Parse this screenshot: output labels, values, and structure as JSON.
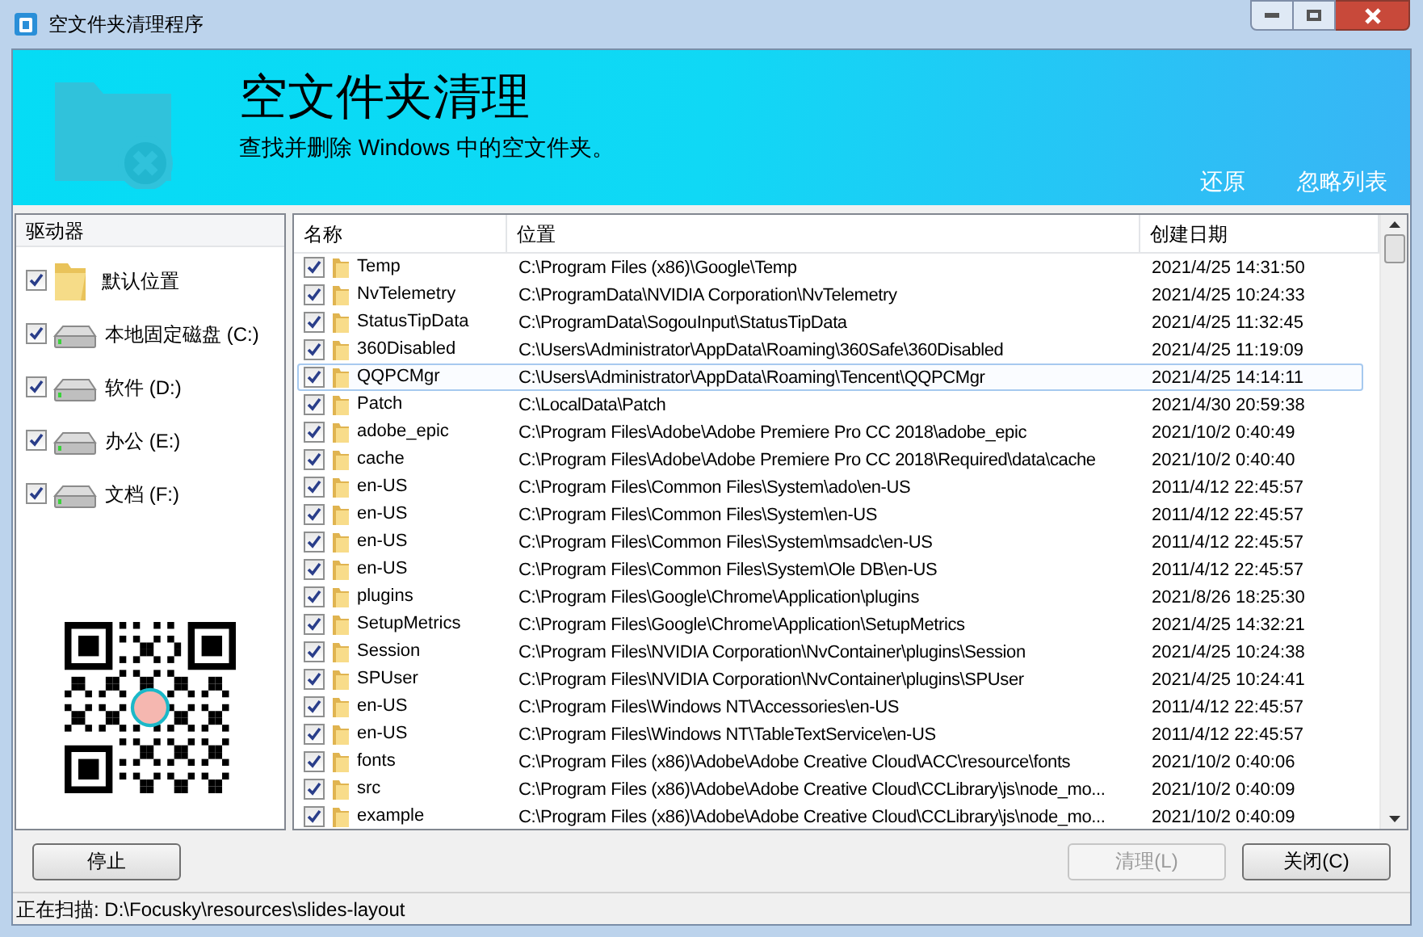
{
  "window": {
    "title": "空文件夹清理程序"
  },
  "header": {
    "title": "空文件夹清理",
    "subtitle": "查找并删除 Windows 中的空文件夹。",
    "links": [
      "还原",
      "忽略列表"
    ]
  },
  "drives": {
    "heading": "驱动器",
    "items": [
      {
        "kind": "folder",
        "label": "默认位置",
        "checked": true
      },
      {
        "kind": "drive",
        "label": "本地固定磁盘 (C:)",
        "checked": true
      },
      {
        "kind": "drive",
        "label": "软件 (D:)",
        "checked": true
      },
      {
        "kind": "drive",
        "label": "办公 (E:)",
        "checked": true
      },
      {
        "kind": "drive",
        "label": "文档 (F:)",
        "checked": true
      }
    ]
  },
  "table": {
    "columns": [
      "名称",
      "位置",
      "创建日期"
    ],
    "rows": [
      {
        "name": "Temp",
        "path": "C:\\Program Files (x86)\\Google\\Temp",
        "date": "2021/4/25 14:31:50",
        "checked": true,
        "selected": false
      },
      {
        "name": "NvTelemetry",
        "path": "C:\\ProgramData\\NVIDIA Corporation\\NvTelemetry",
        "date": "2021/4/25 10:24:33",
        "checked": true,
        "selected": false
      },
      {
        "name": "StatusTipData",
        "path": "C:\\ProgramData\\SogouInput\\StatusTipData",
        "date": "2021/4/25 11:32:45",
        "checked": true,
        "selected": false
      },
      {
        "name": "360Disabled",
        "path": "C:\\Users\\Administrator\\AppData\\Roaming\\360Safe\\360Disabled",
        "date": "2021/4/25 11:19:09",
        "checked": true,
        "selected": false
      },
      {
        "name": "QQPCMgr",
        "path": "C:\\Users\\Administrator\\AppData\\Roaming\\Tencent\\QQPCMgr",
        "date": "2021/4/25 14:14:11",
        "checked": true,
        "selected": true
      },
      {
        "name": "Patch",
        "path": "C:\\LocalData\\Patch",
        "date": "2021/4/30 20:59:38",
        "checked": true,
        "selected": false
      },
      {
        "name": "adobe_epic",
        "path": "C:\\Program Files\\Adobe\\Adobe Premiere Pro CC 2018\\adobe_epic",
        "date": "2021/10/2 0:40:49",
        "checked": true,
        "selected": false
      },
      {
        "name": "cache",
        "path": "C:\\Program Files\\Adobe\\Adobe Premiere Pro CC 2018\\Required\\data\\cache",
        "date": "2021/10/2 0:40:40",
        "checked": true,
        "selected": false
      },
      {
        "name": "en-US",
        "path": "C:\\Program Files\\Common Files\\System\\ado\\en-US",
        "date": "2011/4/12 22:45:57",
        "checked": true,
        "selected": false
      },
      {
        "name": "en-US",
        "path": "C:\\Program Files\\Common Files\\System\\en-US",
        "date": "2011/4/12 22:45:57",
        "checked": true,
        "selected": false
      },
      {
        "name": "en-US",
        "path": "C:\\Program Files\\Common Files\\System\\msadc\\en-US",
        "date": "2011/4/12 22:45:57",
        "checked": true,
        "selected": false
      },
      {
        "name": "en-US",
        "path": "C:\\Program Files\\Common Files\\System\\Ole DB\\en-US",
        "date": "2011/4/12 22:45:57",
        "checked": true,
        "selected": false
      },
      {
        "name": "plugins",
        "path": "C:\\Program Files\\Google\\Chrome\\Application\\plugins",
        "date": "2021/8/26 18:25:30",
        "checked": true,
        "selected": false
      },
      {
        "name": "SetupMetrics",
        "path": "C:\\Program Files\\Google\\Chrome\\Application\\SetupMetrics",
        "date": "2021/4/25 14:32:21",
        "checked": true,
        "selected": false
      },
      {
        "name": "Session",
        "path": "C:\\Program Files\\NVIDIA Corporation\\NvContainer\\plugins\\Session",
        "date": "2021/4/25 10:24:38",
        "checked": true,
        "selected": false
      },
      {
        "name": "SPUser",
        "path": "C:\\Program Files\\NVIDIA Corporation\\NvContainer\\plugins\\SPUser",
        "date": "2021/4/25 10:24:41",
        "checked": true,
        "selected": false
      },
      {
        "name": "en-US",
        "path": "C:\\Program Files\\Windows NT\\Accessories\\en-US",
        "date": "2011/4/12 22:45:57",
        "checked": true,
        "selected": false
      },
      {
        "name": "en-US",
        "path": "C:\\Program Files\\Windows NT\\TableTextService\\en-US",
        "date": "2011/4/12 22:45:57",
        "checked": true,
        "selected": false
      },
      {
        "name": "fonts",
        "path": "C:\\Program Files (x86)\\Adobe\\Adobe Creative Cloud\\ACC\\resource\\fonts",
        "date": "2021/10/2 0:40:06",
        "checked": true,
        "selected": false
      },
      {
        "name": "src",
        "path": "C:\\Program Files (x86)\\Adobe\\Adobe Creative Cloud\\CCLibrary\\js\\node_mo...",
        "date": "2021/10/2 0:40:09",
        "checked": true,
        "selected": false
      },
      {
        "name": "example",
        "path": "C:\\Program Files (x86)\\Adobe\\Adobe Creative Cloud\\CCLibrary\\js\\node_mo...",
        "date": "2021/10/2 0:40:09",
        "checked": true,
        "selected": false
      }
    ]
  },
  "buttons": [
    {
      "label": "停止",
      "disabled": false
    },
    {
      "label": "清理(L)",
      "disabled": true
    },
    {
      "label": "关闭(C)",
      "disabled": false
    }
  ],
  "status_bar": "正在扫描: D:\\Focusky\\resources\\slides-layout"
}
